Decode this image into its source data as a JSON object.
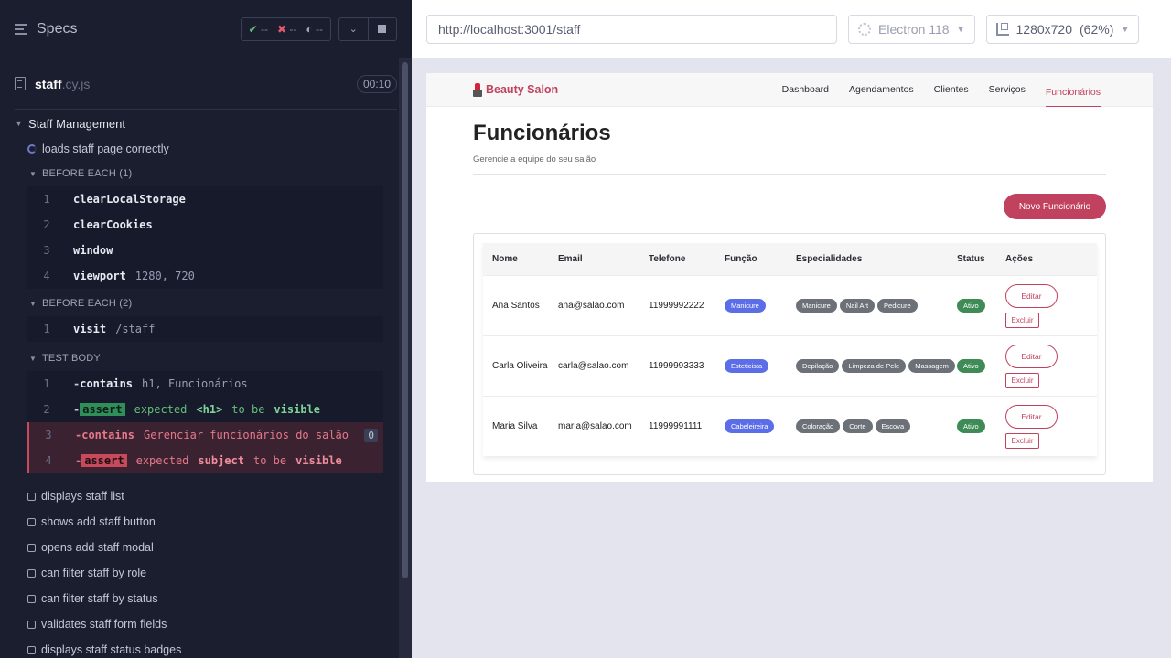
{
  "runner": {
    "specs_label": "Specs",
    "stats": {
      "passed": "--",
      "failed": "--",
      "pending": "--"
    },
    "spec_file": {
      "name": "staff",
      "ext": ".cy.js",
      "duration": "00:10"
    },
    "suite_title": "Staff Management",
    "running_test": "loads staff page correctly",
    "hooks": [
      {
        "title": "BEFORE EACH (1)",
        "commands": [
          {
            "num": "1",
            "name": "clearLocalStorage",
            "msg": ""
          },
          {
            "num": "2",
            "name": "clearCookies",
            "msg": ""
          },
          {
            "num": "3",
            "name": "window",
            "msg": ""
          },
          {
            "num": "4",
            "name": "viewport",
            "msg": "1280, 720"
          }
        ]
      },
      {
        "title": "BEFORE EACH (2)",
        "commands": [
          {
            "num": "1",
            "name": "visit",
            "msg": "/staff"
          }
        ]
      }
    ],
    "test_body": {
      "title": "TEST BODY",
      "commands": [
        {
          "num": "1",
          "dash": "-",
          "name": "contains",
          "msg": "h1, Funcionários"
        },
        {
          "num": "2",
          "dash": "-",
          "tag": "assert",
          "w1": "expected",
          "w2": "<h1>",
          "w3": "to be",
          "w4": "visible"
        },
        {
          "num": "3",
          "dash": "-",
          "name": "contains",
          "msg": "Gerenciar funcionários do salão",
          "count": "0"
        },
        {
          "num": "4",
          "dash": "-",
          "tag": "assert",
          "w1": "expected",
          "w2": "subject",
          "w3": "to be",
          "w4": "visible"
        }
      ]
    },
    "pending_tests": [
      "displays staff list",
      "shows add staff button",
      "opens add staff modal",
      "can filter staff by role",
      "can filter staff by status",
      "validates staff form fields",
      "displays staff status badges"
    ]
  },
  "aut": {
    "url": "http://localhost:3001/staff",
    "browser": "Electron 118",
    "viewport": "1280x720",
    "zoom": "(62%)"
  },
  "app": {
    "logo": "Beauty Salon",
    "nav": [
      "Dashboard",
      "Agendamentos",
      "Clientes",
      "Serviços",
      "Funcionários"
    ],
    "active_nav": "Funcionários",
    "title": "Funcionários",
    "subtitle": "Gerencie a equipe do seu salão",
    "new_button": "Novo Funcionário",
    "table": {
      "headers": [
        "Nome",
        "Email",
        "Telefone",
        "Função",
        "Especialidades",
        "Status",
        "Ações"
      ],
      "edit_label": "Editar",
      "delete_label": "Excluir",
      "rows": [
        {
          "name": "Ana Santos",
          "email": "ana@salao.com",
          "phone": "11999992222",
          "role": "Manicure",
          "specialties": [
            "Manicure",
            "Nail Art",
            "Pedicure"
          ],
          "status": "Ativo"
        },
        {
          "name": "Carla Oliveira",
          "email": "carla@salao.com",
          "phone": "11999993333",
          "role": "Esteticista",
          "specialties": [
            "Depilação",
            "Limpeza de Pele",
            "Massagem"
          ],
          "status": "Ativo"
        },
        {
          "name": "Maria Silva",
          "email": "maria@salao.com",
          "phone": "11999991111",
          "role": "Cabeleireira",
          "specialties": [
            "Coloração",
            "Corte",
            "Escova"
          ],
          "status": "Ativo"
        }
      ]
    }
  },
  "colors": {
    "accent": "#c0425e",
    "role_badge": "#5b6ee8",
    "spec_badge": "#6c7178",
    "status_badge": "#3e8b55",
    "runner_bg": "#1b1e2e"
  }
}
